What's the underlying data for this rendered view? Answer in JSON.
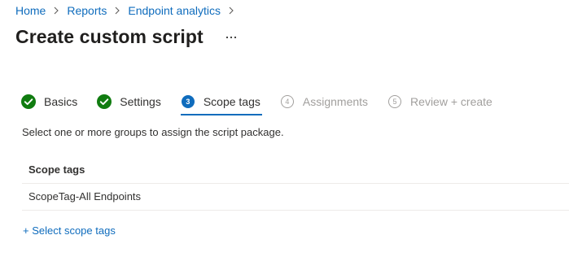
{
  "breadcrumb": {
    "items": [
      "Home",
      "Reports",
      "Endpoint analytics"
    ]
  },
  "header": {
    "title": "Create custom script",
    "more_icon": "ellipsis-icon"
  },
  "wizard": {
    "steps": [
      {
        "label": "Basics",
        "state": "completed",
        "number": "1"
      },
      {
        "label": "Settings",
        "state": "completed",
        "number": "2"
      },
      {
        "label": "Scope tags",
        "state": "active",
        "number": "3"
      },
      {
        "label": "Assignments",
        "state": "disabled",
        "number": "4"
      },
      {
        "label": "Review + create",
        "state": "disabled",
        "number": "5"
      }
    ]
  },
  "content": {
    "instruction": "Select one or more groups to assign the script package.",
    "table": {
      "header": "Scope tags",
      "rows": [
        "ScopeTag-All Endpoints"
      ]
    },
    "select_link": "+ Select scope tags"
  },
  "colors": {
    "link": "#0f6cbd",
    "success": "#107c10",
    "disabled": "#a19f9d",
    "text": "#323130"
  }
}
